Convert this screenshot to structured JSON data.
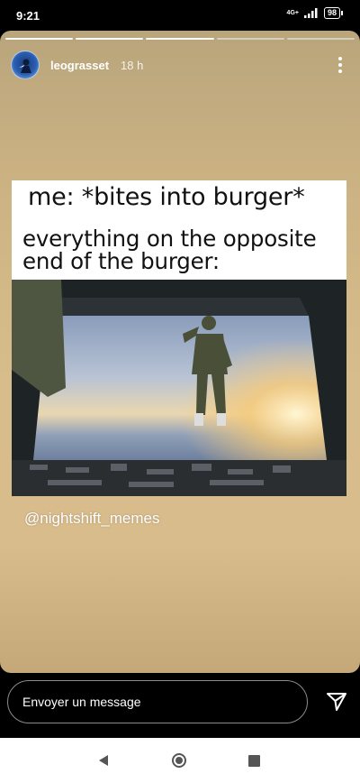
{
  "status_bar": {
    "time": "9:21",
    "network_type": "4G+",
    "battery": "98"
  },
  "story": {
    "progress": {
      "segments": 5,
      "current": 3
    },
    "username": "leograsset",
    "time_ago": "18 h",
    "meme": {
      "caption_line1": "me: *bites into burger*",
      "caption_line2": "everything on the opposite end of the burger:"
    },
    "mention": "@nightshift_memes"
  },
  "message_bar": {
    "placeholder": "Envoyer un message"
  },
  "icons": {
    "more": "more-vertical-icon",
    "send": "send-icon",
    "back": "nav-back-icon",
    "home": "nav-home-icon",
    "recents": "nav-recents-icon"
  }
}
